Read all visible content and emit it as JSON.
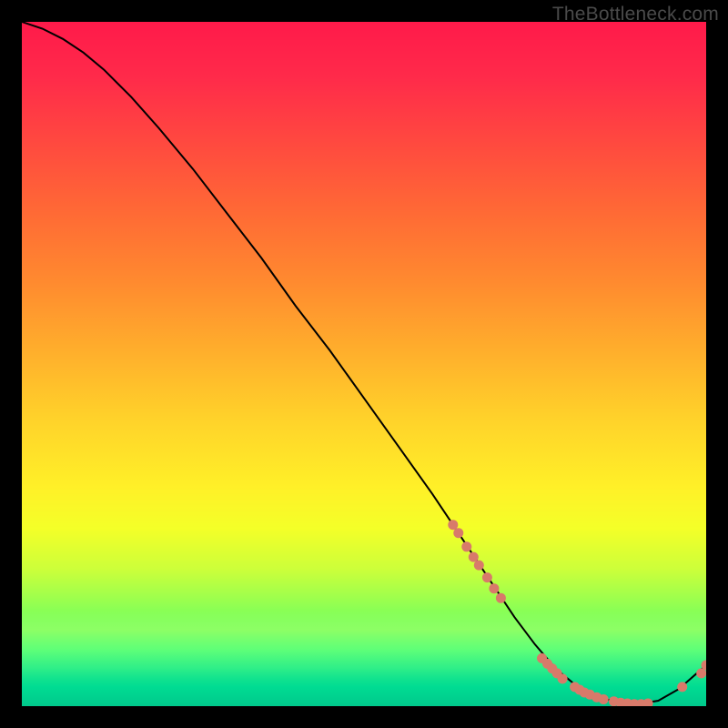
{
  "watermark": "TheBottleneck.com",
  "colors": {
    "line": "#000000",
    "marker": "#d87a6a",
    "bg_top": "#ff1a4a",
    "bg_bottom": "#00d08a"
  },
  "chart_data": {
    "type": "line",
    "title": "",
    "xlabel": "",
    "ylabel": "",
    "xlim": [
      0,
      100
    ],
    "ylim": [
      0,
      100
    ],
    "grid": false,
    "legend": false,
    "x": [
      0,
      3,
      6,
      9,
      12,
      16,
      20,
      25,
      30,
      35,
      40,
      45,
      50,
      55,
      60,
      63,
      66,
      69,
      72,
      75,
      78,
      81,
      84,
      87,
      90,
      93,
      96,
      100
    ],
    "y": [
      100,
      99,
      97.5,
      95.5,
      93,
      89,
      84.5,
      78.5,
      72,
      65.5,
      58.5,
      52,
      45,
      38,
      31,
      26.5,
      22,
      17.5,
      13,
      9,
      5.5,
      3,
      1.4,
      0.6,
      0.3,
      0.8,
      2.5,
      6
    ],
    "markers": [
      {
        "x": 63.0,
        "y": 26.5
      },
      {
        "x": 63.8,
        "y": 25.3
      },
      {
        "x": 65.0,
        "y": 23.3
      },
      {
        "x": 66.0,
        "y": 21.8
      },
      {
        "x": 66.8,
        "y": 20.6
      },
      {
        "x": 68.0,
        "y": 18.8
      },
      {
        "x": 69.0,
        "y": 17.2
      },
      {
        "x": 70.0,
        "y": 15.8
      },
      {
        "x": 76.0,
        "y": 7.0
      },
      {
        "x": 76.8,
        "y": 6.2
      },
      {
        "x": 77.5,
        "y": 5.5
      },
      {
        "x": 78.2,
        "y": 4.8
      },
      {
        "x": 79.0,
        "y": 4.0
      },
      {
        "x": 80.8,
        "y": 2.8
      },
      {
        "x": 81.5,
        "y": 2.4
      },
      {
        "x": 82.2,
        "y": 2.0
      },
      {
        "x": 83.0,
        "y": 1.7
      },
      {
        "x": 84.0,
        "y": 1.3
      },
      {
        "x": 85.0,
        "y": 1.0
      },
      {
        "x": 86.5,
        "y": 0.7
      },
      {
        "x": 87.5,
        "y": 0.5
      },
      {
        "x": 88.5,
        "y": 0.4
      },
      {
        "x": 89.5,
        "y": 0.3
      },
      {
        "x": 90.5,
        "y": 0.3
      },
      {
        "x": 91.5,
        "y": 0.4
      },
      {
        "x": 96.5,
        "y": 2.8
      },
      {
        "x": 99.3,
        "y": 4.8
      },
      {
        "x": 100.0,
        "y": 6.0
      }
    ]
  }
}
